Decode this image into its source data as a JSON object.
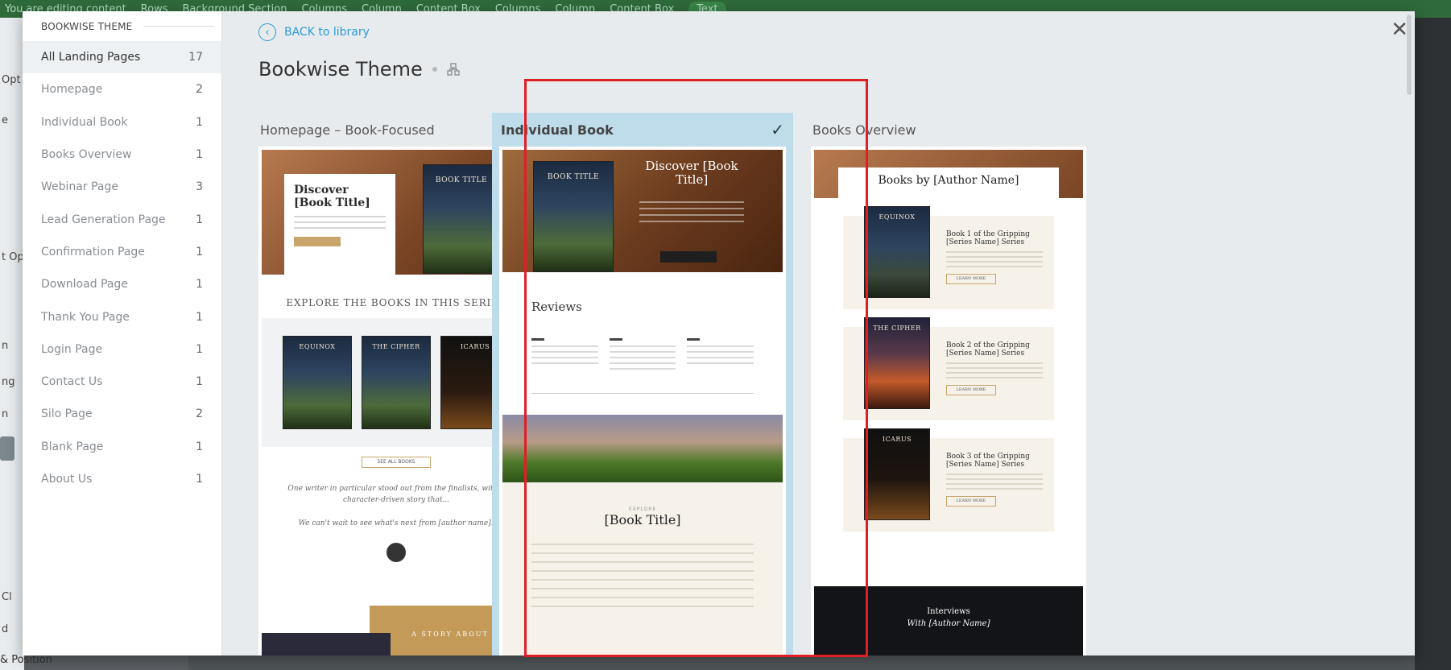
{
  "background": {
    "topbar_items": [
      "You are editing content",
      "Rows",
      "Background Section",
      "Columns",
      "Column",
      "Content Box",
      "Columns",
      "Column",
      "Content Box",
      "Text"
    ],
    "left_fragments": [
      "Opt",
      "e",
      "t Op",
      "n",
      "ng",
      "n",
      "Cl",
      "d",
      "& Position"
    ]
  },
  "sidebar": {
    "header": "BOOKWISE THEME",
    "items": [
      {
        "label": "All Landing Pages",
        "count": "17"
      },
      {
        "label": "Homepage",
        "count": "2"
      },
      {
        "label": "Individual Book",
        "count": "1"
      },
      {
        "label": "Books Overview",
        "count": "1"
      },
      {
        "label": "Webinar Page",
        "count": "3"
      },
      {
        "label": "Lead Generation Page",
        "count": "1"
      },
      {
        "label": "Confirmation Page",
        "count": "1"
      },
      {
        "label": "Download Page",
        "count": "1"
      },
      {
        "label": "Thank You Page",
        "count": "1"
      },
      {
        "label": "Login Page",
        "count": "1"
      },
      {
        "label": "Contact Us",
        "count": "1"
      },
      {
        "label": "Silo Page",
        "count": "2"
      },
      {
        "label": "Blank Page",
        "count": "1"
      },
      {
        "label": "About Us",
        "count": "1"
      }
    ]
  },
  "main": {
    "back_label": "BACK to library",
    "title": "Bookwise Theme",
    "cards": [
      {
        "label": "Homepage – Book-Focused"
      },
      {
        "label": "Individual Book"
      },
      {
        "label": "Books Overview"
      }
    ]
  },
  "previews": {
    "home": {
      "hero_title": "Discover [Book Title]",
      "cover_title": "BOOK TITLE",
      "section_heading": "EXPLORE THE BOOKS IN THIS SERIES",
      "series": [
        "EQUINOX",
        "THE CIPHER",
        "ICARUS"
      ],
      "see_all": "SEE ALL BOOKS",
      "quote": "One writer in particular stood out from the finalists, with a character-driven story that...",
      "quote2": "We can't wait to see what's next from [author name]!",
      "story": "A STORY ABOUT"
    },
    "individual": {
      "cover_title": "BOOK TITLE",
      "hero_title": "Discover [Book Title]",
      "reviews": "Reviews",
      "section_small": "EXPLORE",
      "book_title": "[Book Title]"
    },
    "overview": {
      "heading": "Books by [Author Name]",
      "books": [
        {
          "cover": "EQUINOX",
          "title": "Book 1 of the Gripping [Series Name] Series"
        },
        {
          "cover": "THE CIPHER",
          "title": "Book 2 of the Gripping [Series Name] Series"
        },
        {
          "cover": "ICARUS",
          "title": "Book 3 of the Gripping [Series Name] Series"
        }
      ],
      "learn_more": "LEARN MORE",
      "interviews": "Interviews",
      "interviews_sub": "With [Author Name]"
    }
  },
  "colors": {
    "accent": "#2a9bd4",
    "selected_bg": "#bfdceb",
    "highlight": "#e01e26"
  }
}
